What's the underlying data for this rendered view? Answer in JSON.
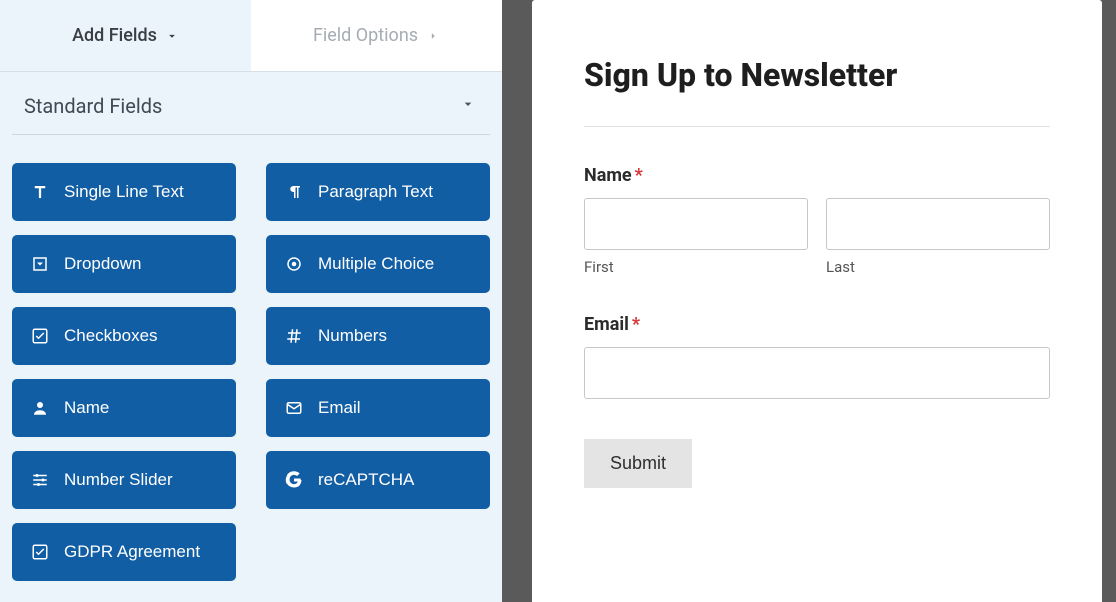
{
  "tabs": {
    "add_fields": "Add Fields",
    "field_options": "Field Options"
  },
  "section": {
    "title": "Standard Fields"
  },
  "fields": {
    "single_line_text": "Single Line Text",
    "paragraph_text": "Paragraph Text",
    "dropdown": "Dropdown",
    "multiple_choice": "Multiple Choice",
    "checkboxes": "Checkboxes",
    "numbers": "Numbers",
    "name": "Name",
    "email": "Email",
    "number_slider": "Number Slider",
    "recaptcha": "reCAPTCHA",
    "gdpr": "GDPR Agreement"
  },
  "form": {
    "title": "Sign Up to Newsletter",
    "name_label": "Name",
    "first_label": "First",
    "last_label": "Last",
    "email_label": "Email",
    "submit": "Submit",
    "required_mark": "*"
  }
}
